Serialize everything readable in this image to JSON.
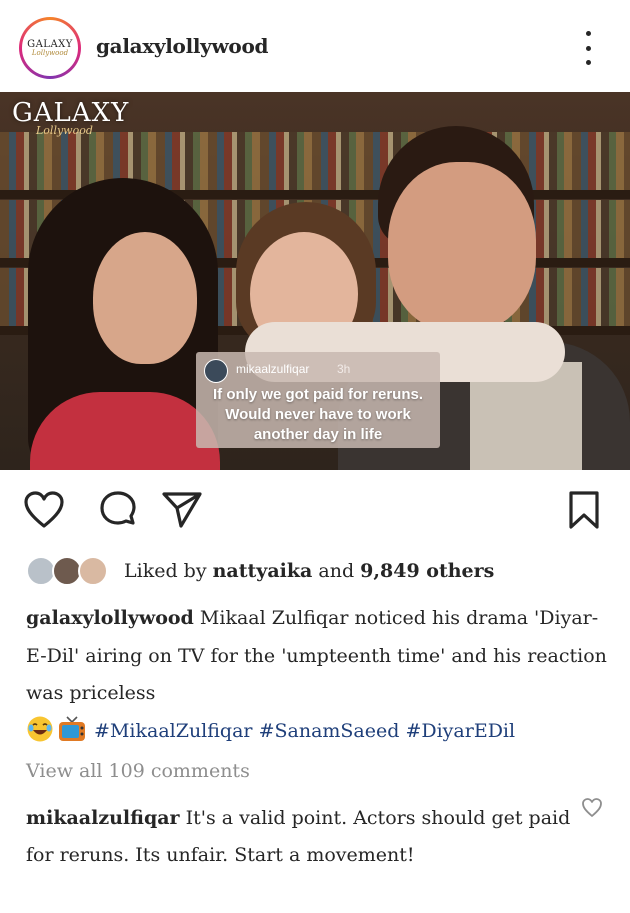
{
  "post": {
    "username": "galaxylollywood",
    "avatar_logo": "GALAXY",
    "avatar_logo_sub": "Lollywood",
    "more_icon": "more-vertical-icon"
  },
  "photo": {
    "watermark": "GALAXY",
    "watermark_sub": "Lollywood",
    "overlay": {
      "username": "mikaalzulfiqar",
      "time": "3h",
      "text_line1": "If only we got paid for reruns.",
      "text_line2": "Would never have to work",
      "text_line3": "another day in life"
    }
  },
  "actions": {
    "like_icon": "heart-icon",
    "comment_icon": "comment-icon",
    "share_icon": "send-icon",
    "save_icon": "bookmark-icon"
  },
  "likes": {
    "prefix": "Liked by",
    "user": "nattyaika",
    "and": "and",
    "count": "9,849 others"
  },
  "caption": {
    "username": "galaxylollywood",
    "text": "Mikaal Zulfiqar noticed his drama 'Diyar-E-Dil' airing on TV for the 'umpteenth time' and his reaction was priceless",
    "emojis": [
      "laughing-emoji",
      "television-emoji"
    ],
    "hashtags": [
      "#MikaalZulfiqar",
      "#SanamSaeed",
      "#DiyarEDil"
    ]
  },
  "view_all": "View all 109 comments",
  "top_comment": {
    "username": "mikaalzulfiqar",
    "text": "It's a valid point. Actors should get paid for reruns. Its unfair. Start a movement!"
  },
  "colors": {
    "hashtag": "#1f3f7a",
    "muted": "#8e8e8e",
    "text": "#262626"
  }
}
